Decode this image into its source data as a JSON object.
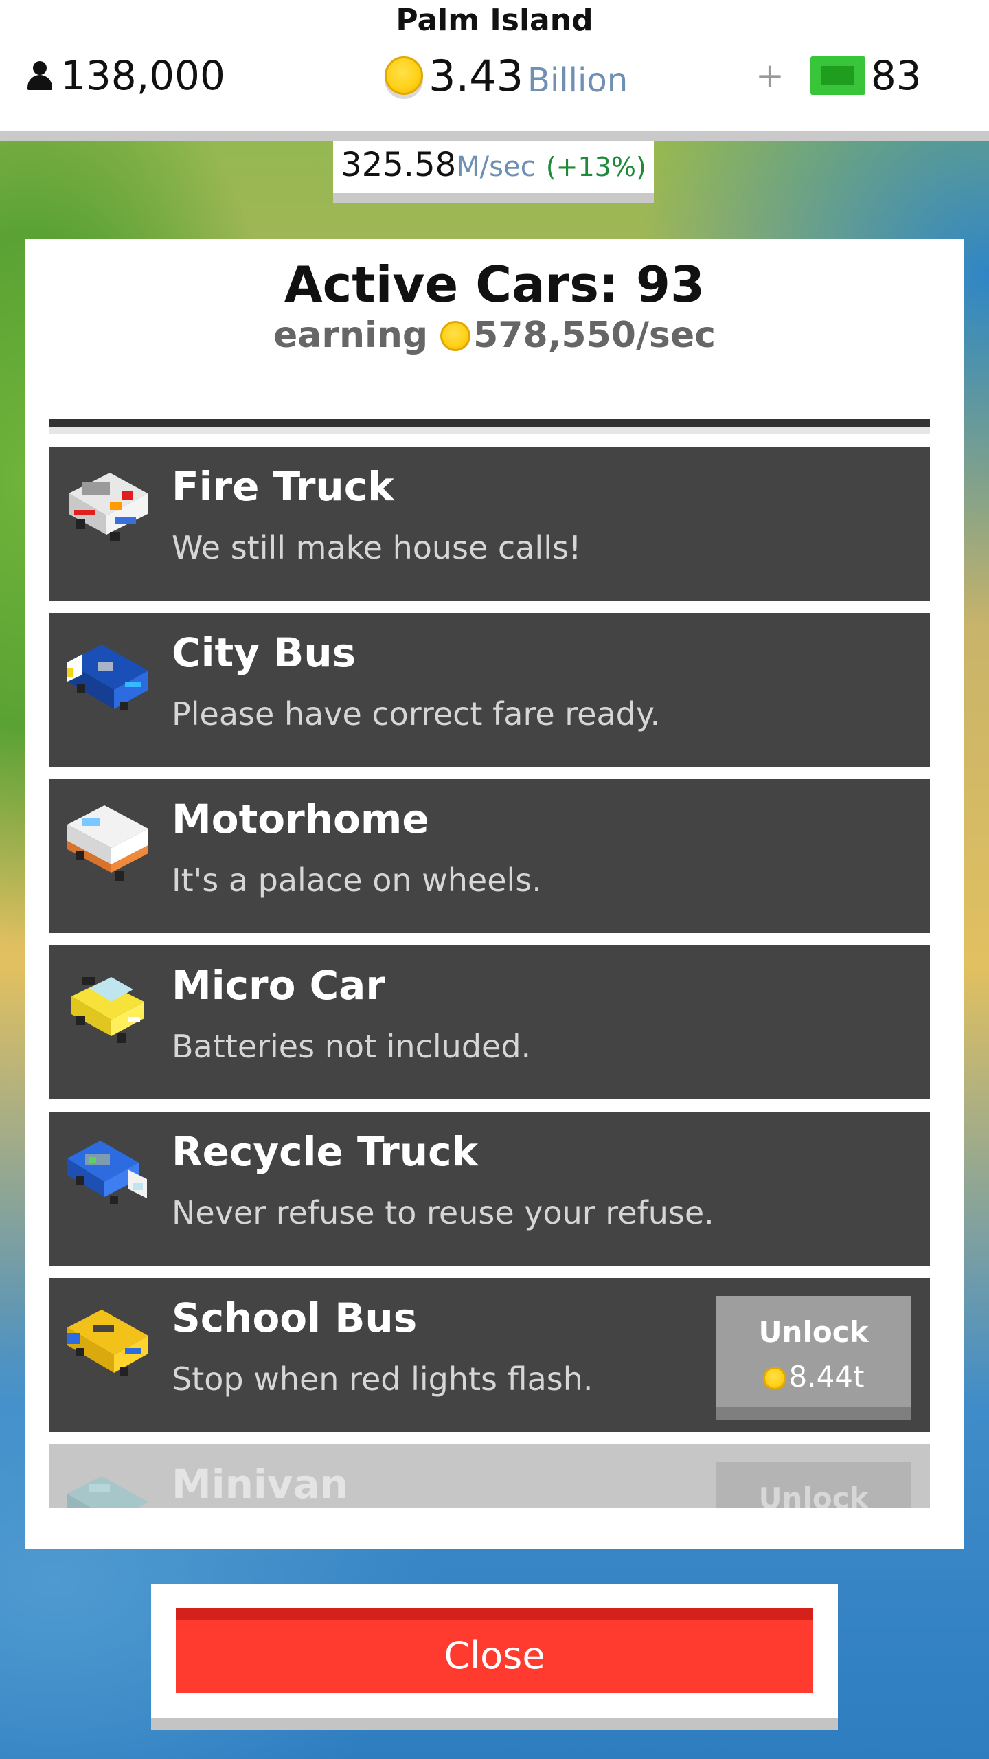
{
  "hud": {
    "island_name": "Palm Island",
    "population": "138,000",
    "money_value": "3.43",
    "money_unit": "Billion",
    "plus": "+",
    "cash": "83",
    "rate_value": "325.58",
    "rate_unit": "M/sec",
    "rate_bonus": "(+13%)"
  },
  "panel": {
    "title": "Active Cars: 93",
    "earning_label": "earning",
    "earning_value": "578,550/sec"
  },
  "cars": [
    {
      "name": "Fire Truck",
      "desc": "We still make house calls!",
      "icon": "fire-truck-icon"
    },
    {
      "name": "City Bus",
      "desc": "Please have correct fare ready.",
      "icon": "city-bus-icon"
    },
    {
      "name": "Motorhome",
      "desc": "It's a palace on wheels.",
      "icon": "motorhome-icon"
    },
    {
      "name": "Micro Car",
      "desc": "Batteries not included.",
      "icon": "micro-car-icon"
    },
    {
      "name": "Recycle Truck",
      "desc": "Never refuse to reuse your refuse.",
      "icon": "recycle-truck-icon"
    },
    {
      "name": "School Bus",
      "desc": "Stop when red lights flash.",
      "icon": "school-bus-icon",
      "unlock_label": "Unlock",
      "unlock_cost": "8.44t"
    },
    {
      "name": "Minivan",
      "desc": "",
      "icon": "minivan-icon",
      "unlock_label": "Unlock"
    }
  ],
  "close_label": "Close",
  "colors": {
    "close_button": "#ff3b2f",
    "rate_bonus": "#1f8a3a",
    "unit_blue": "#6f8fb3",
    "row_bg": "#444444"
  }
}
